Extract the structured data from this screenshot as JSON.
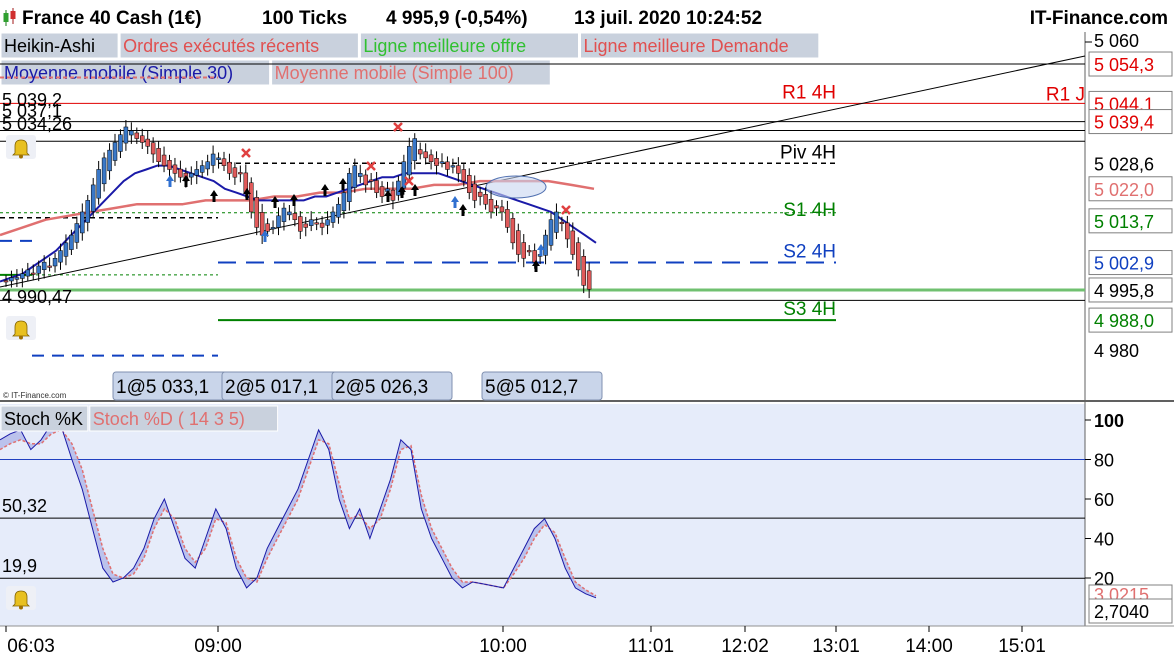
{
  "header": {
    "instrument": "France 40 Cash (1€)",
    "interval": "100 Ticks",
    "last_change": "4 995,9 (-0,54%)",
    "datetime": "13 juil. 2020 10:24:52",
    "brand": "IT-Finance.com"
  },
  "legend_main_row1": [
    {
      "label": "Heikin-Ashi",
      "color": "#000000"
    },
    {
      "label": "Ordres exécutés récents",
      "color": "#e05050"
    },
    {
      "label": "Ligne meilleure offre",
      "color": "#30c030"
    },
    {
      "label": "Ligne meilleure Demande",
      "color": "#e05050"
    }
  ],
  "legend_main_row2": [
    {
      "label": "Moyenne mobile (Simple 30)",
      "color": "#1a1aa8"
    },
    {
      "label": "Moyenne mobile (Simple 100)",
      "color": "#e07070"
    }
  ],
  "legend_stoch": [
    {
      "label": "Stoch %K",
      "color": "#000000"
    },
    {
      "label": "Stoch %D ( 14 3 5)",
      "color": "#e07070"
    }
  ],
  "copyright": "© IT-Finance.com",
  "colors": {
    "up_candle": "#3a78c8",
    "down_candle": "#e05a5a",
    "ma30": "#1a1aa8",
    "ma100": "#e07070",
    "stoch_k": "#1a1aa8",
    "stoch_d": "#e07070",
    "stoch_bg": "#e6ecfa",
    "r1": "#e00000",
    "s_lines": "#008000",
    "s2": "#1040c0",
    "piv": "#000000"
  },
  "left_labels": [
    {
      "text": "5 039,2",
      "price": 5039.2
    },
    {
      "text": "5 037,1",
      "price": 5037.1
    },
    {
      "text": "5 034,26",
      "price": 5034.26
    },
    {
      "text": "4 990,47",
      "price": 4990.47
    }
  ],
  "pivot_labels": [
    {
      "text": "R1 J",
      "price": 5046.2,
      "color": "#e00000"
    },
    {
      "text": "R1 4H",
      "price": 5044.1,
      "color": "#e00000"
    },
    {
      "text": "Piv 4H",
      "price": 5028.6,
      "color": "#000000"
    },
    {
      "text": "S1 4H",
      "price": 5013.7,
      "color": "#008000"
    },
    {
      "text": "S2 4H",
      "price": 5002.9,
      "color": "#1040c0"
    },
    {
      "text": "S3 4H",
      "price": 4988.0,
      "color": "#008000"
    }
  ],
  "order_boxes": [
    "1@5 033,1",
    "2@5 017,1",
    "2@5 026,3",
    "5@5 012,7"
  ],
  "price_axis": {
    "ticks": [
      "5 060",
      "5 028,6",
      "4 980"
    ],
    "boxes": [
      {
        "text": "5 054,3",
        "price": 5054.3,
        "color": "#e00000"
      },
      {
        "text": "5 044,1",
        "price": 5044.1,
        "color": "#e00000"
      },
      {
        "text": "5 039,4",
        "price": 5039.4,
        "color": "#e00000"
      },
      {
        "text": "5 022,0",
        "price": 5022.0,
        "color": "#e07070"
      },
      {
        "text": "5 013,7",
        "price": 5013.7,
        "color": "#008000"
      },
      {
        "text": "5 002,9",
        "price": 5002.9,
        "color": "#1040c0"
      },
      {
        "text": "4 995,8",
        "price": 4995.8,
        "color": "#000000"
      },
      {
        "text": "4 988,0",
        "price": 4988.0,
        "color": "#008000"
      }
    ]
  },
  "stoch_axis": {
    "ticks": [
      "100",
      "80",
      "60",
      "40",
      "20"
    ],
    "boxes": [
      "3,0215",
      "2,7040"
    ],
    "left_labels": [
      "50,32",
      "19,9"
    ]
  },
  "time_axis": [
    "06:03",
    "09:00",
    "10:00",
    "11:01",
    "12:02",
    "13:01",
    "14:00",
    "15:01"
  ],
  "chart_data": {
    "type": "candlestick",
    "title": "France 40 Cash (1€)",
    "candles_close": [
      4998,
      4999,
      4999,
      5000,
      5001,
      5000,
      5002,
      5003,
      5002,
      5004,
      5006,
      5008,
      5010,
      5013,
      5016,
      5019,
      5023,
      5027,
      5030,
      5032,
      5034,
      5036,
      5038,
      5037,
      5035,
      5034,
      5033,
      5031,
      5029,
      5028,
      5027,
      5026,
      5025,
      5024,
      5026,
      5027,
      5028,
      5029,
      5031,
      5030,
      5028,
      5026,
      5025,
      5026,
      5021,
      5016,
      5012,
      5010,
      5011,
      5012,
      5015,
      5017,
      5016,
      5014,
      5011,
      5012,
      5014,
      5013,
      5012,
      5014,
      5016,
      5018,
      5021,
      5026,
      5028,
      5026,
      5023,
      5024,
      5021,
      5020,
      5022,
      5019,
      5024,
      5029,
      5033,
      5035,
      5031,
      5030,
      5029,
      5028,
      5029,
      5027,
      5028,
      5026,
      5024,
      5021,
      5019,
      5020,
      5018,
      5016,
      5017,
      5016,
      5012,
      5008,
      5005,
      5004,
      5006,
      5003,
      5005,
      5010,
      5014,
      5016,
      5013,
      5009,
      5005,
      5001,
      4997,
      4996
    ],
    "ma30": [
      4998,
      4999,
      5000,
      5002,
      5004,
      5006,
      5009,
      5012,
      5015,
      5018,
      5021,
      5024,
      5026,
      5027,
      5028,
      5028,
      5027,
      5026,
      5025,
      5024,
      5022,
      5021,
      5020,
      5019,
      5019,
      5019,
      5019,
      5019,
      5020,
      5020,
      5021,
      5022,
      5023,
      5024,
      5025,
      5025,
      5026,
      5026,
      5026,
      5026,
      5025,
      5024,
      5023,
      5022,
      5021,
      5020,
      5019,
      5018,
      5017,
      5016,
      5014,
      5012,
      5010,
      5008
    ],
    "ma100": [
      5010,
      5012,
      5014,
      5015,
      5016,
      5017,
      5018,
      5018,
      5018,
      5019,
      5019,
      5019,
      5020,
      5020,
      5021,
      5021,
      5022,
      5022,
      5022,
      5023,
      5023,
      5024,
      5024,
      5024,
      5024,
      5023,
      5022
    ],
    "stoch_k": [
      90,
      93,
      95,
      85,
      90,
      98,
      96,
      80,
      65,
      45,
      25,
      18,
      20,
      25,
      35,
      50,
      60,
      45,
      30,
      25,
      40,
      55,
      45,
      25,
      15,
      20,
      35,
      45,
      55,
      65,
      80,
      95,
      85,
      60,
      45,
      55,
      40,
      55,
      70,
      90,
      85,
      55,
      40,
      30,
      20,
      15,
      18,
      17,
      16,
      15,
      25,
      35,
      45,
      50,
      40,
      25,
      15,
      12,
      10
    ],
    "stoch_d": [
      85,
      88,
      90,
      88,
      88,
      93,
      95,
      88,
      75,
      55,
      35,
      22,
      20,
      22,
      30,
      45,
      55,
      50,
      35,
      28,
      35,
      50,
      48,
      30,
      20,
      18,
      30,
      40,
      50,
      60,
      75,
      90,
      88,
      68,
      50,
      52,
      45,
      50,
      65,
      85,
      87,
      62,
      45,
      35,
      25,
      18,
      18,
      17,
      16,
      15,
      22,
      30,
      40,
      47,
      43,
      30,
      18,
      14,
      11
    ],
    "y_range_main": [
      4977,
      5068
    ],
    "y_range_stoch": [
      0,
      100
    ]
  }
}
